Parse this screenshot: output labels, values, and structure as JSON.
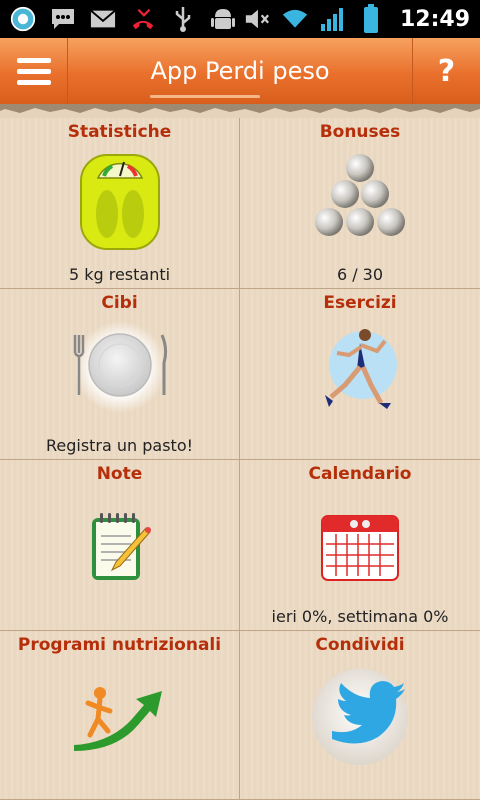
{
  "status_bar": {
    "time": "12:49",
    "icons_left": [
      "cyanogen-icon",
      "chat-icon",
      "mail-icon",
      "missed-call-icon",
      "usb-icon",
      "android-debug-icon"
    ],
    "icons_right": [
      "mute-icon",
      "wifi-icon",
      "signal-icon",
      "battery-icon"
    ]
  },
  "app_bar": {
    "title": "App Perdi peso",
    "help_label": "?",
    "menu_icon": "hamburger-menu-icon"
  },
  "tiles": [
    {
      "title": "Statistiche",
      "subtitle": "5 kg restanti",
      "icon": "scale-icon"
    },
    {
      "title": "Bonuses",
      "subtitle": "6 / 30",
      "icon": "pearls-icon"
    },
    {
      "title": "Cibi",
      "subtitle": "Registra un pasto!",
      "icon": "plate-icon"
    },
    {
      "title": "Esercizi",
      "subtitle": "",
      "icon": "runner-icon"
    },
    {
      "title": "Note",
      "subtitle": "",
      "icon": "notepad-icon"
    },
    {
      "title": "Calendario",
      "subtitle": "ieri 0%, settimana 0%",
      "icon": "calendar-icon"
    },
    {
      "title": "Programi nutrizionali",
      "subtitle": "",
      "icon": "progress-arrow-icon"
    },
    {
      "title": "Condividi",
      "subtitle": "",
      "icon": "twitter-icon"
    }
  ],
  "colors": {
    "app_bar": "#e9702c",
    "tile_title": "#b52f0b",
    "background": "#e6d3bb"
  }
}
